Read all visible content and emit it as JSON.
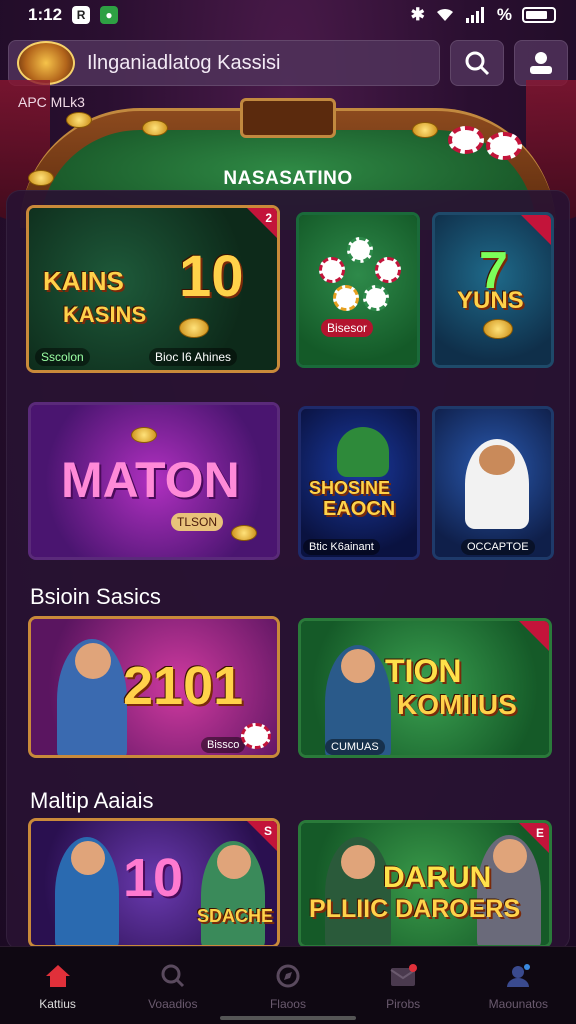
{
  "status_bar": {
    "time": "1:12",
    "signal_text": "%"
  },
  "header": {
    "search_text": "Ilnganiadlatog Kassisi",
    "promo_label": "APC MLk3"
  },
  "table": {
    "title": "NASASATINO"
  },
  "featured": [
    {
      "title_a": "KAINS",
      "title_b": "KASINS",
      "number": "10",
      "caption_left": "Sscolon",
      "caption_right": "Bioc I6 Ahines",
      "corner": "2"
    },
    {
      "caption": "Bisesor"
    },
    {
      "number": "7",
      "title": "YUNS"
    }
  ],
  "row2": [
    {
      "title": "MATON",
      "subtitle": "TLSON"
    },
    {
      "title_a": "SHOSINE",
      "title_b": "EAOCN",
      "caption": "Btic K6ainant"
    },
    {
      "caption": "OCCAPTOE"
    }
  ],
  "section1": {
    "title": "Bsioin Sasics",
    "tiles": [
      {
        "number": "2101",
        "caption": "Bissco"
      },
      {
        "title_a": "TION",
        "title_b": "KOMIIUS",
        "caption": "CUMUAS"
      }
    ]
  },
  "section2": {
    "title": "Maltip Aaiais",
    "tiles": [
      {
        "number": "10",
        "title": "SDACHE",
        "corner": "S"
      },
      {
        "title_a": "DARUN",
        "title_b": "PLLIIC DAROERS",
        "corner": "E"
      }
    ]
  },
  "nav": [
    {
      "label": "Kattius",
      "icon": "home-icon",
      "active": true
    },
    {
      "label": "Voaadios",
      "icon": "search-icon",
      "active": false
    },
    {
      "label": "Flaoos",
      "icon": "compass-icon",
      "active": false
    },
    {
      "label": "Pirobs",
      "icon": "mail-icon",
      "active": false
    },
    {
      "label": "Maounatos",
      "icon": "profile-icon",
      "active": false
    }
  ],
  "colors": {
    "accent_gold": "#ffd24a",
    "frame": "#c98a3a",
    "corner_red": "#c3143a",
    "active_nav": "#e0303a"
  }
}
